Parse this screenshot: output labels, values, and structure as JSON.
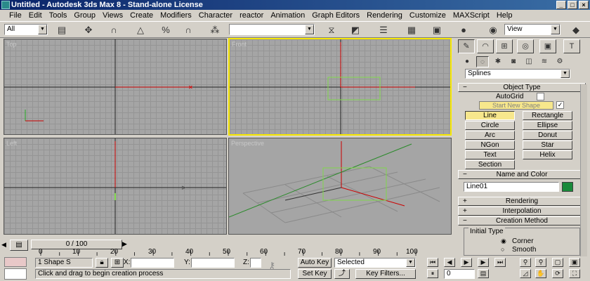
{
  "window": {
    "title": "Untitled - Autodesk 3ds Max 8 - Stand-alone License"
  },
  "menu": [
    "File",
    "Edit",
    "Tools",
    "Group",
    "Views",
    "Create",
    "Modifiers",
    "Character",
    "reactor",
    "Animation",
    "Graph Editors",
    "Rendering",
    "Customize",
    "MAXScript",
    "Help"
  ],
  "toolbar": {
    "selection_filter": "All",
    "coord_system": "View",
    "named_selection": ""
  },
  "viewports": {
    "top": "Top",
    "front": "Front",
    "left": "Left",
    "perspective": "Perspective"
  },
  "command_panel": {
    "category": "Splines",
    "object_type_title": "Object Type",
    "autogrid_label": "AutoGrid",
    "start_new_shape_label": "Start New Shape",
    "buttons": [
      "Line",
      "Rectangle",
      "Circle",
      "Ellipse",
      "Arc",
      "Donut",
      "NGon",
      "Star",
      "Text",
      "Helix",
      "Section"
    ],
    "name_color_title": "Name and Color",
    "object_name": "Line01",
    "object_color": "#1a8a3a",
    "rendering_title": "Rendering",
    "interpolation_title": "Interpolation",
    "creation_method_title": "Creation Method",
    "initial_type_label": "Initial Type",
    "radio_corner": "Corner",
    "radio_smooth": "Smooth"
  },
  "timeline": {
    "slider": "0 / 100",
    "ticks": [
      "0",
      "10",
      "20",
      "30",
      "40",
      "50",
      "60",
      "70",
      "80",
      "90",
      "100"
    ]
  },
  "status": {
    "selection": "1 Shape S",
    "x_label": "X:",
    "y_label": "Y:",
    "z_label": "Z:",
    "x": "",
    "y": "",
    "z": "",
    "prompt": "Click and drag to begin creation process",
    "auto_key": "Auto Key",
    "set_key": "Set Key",
    "key_mode": "Selected",
    "key_filters": "Key Filters...",
    "frame": "0"
  }
}
